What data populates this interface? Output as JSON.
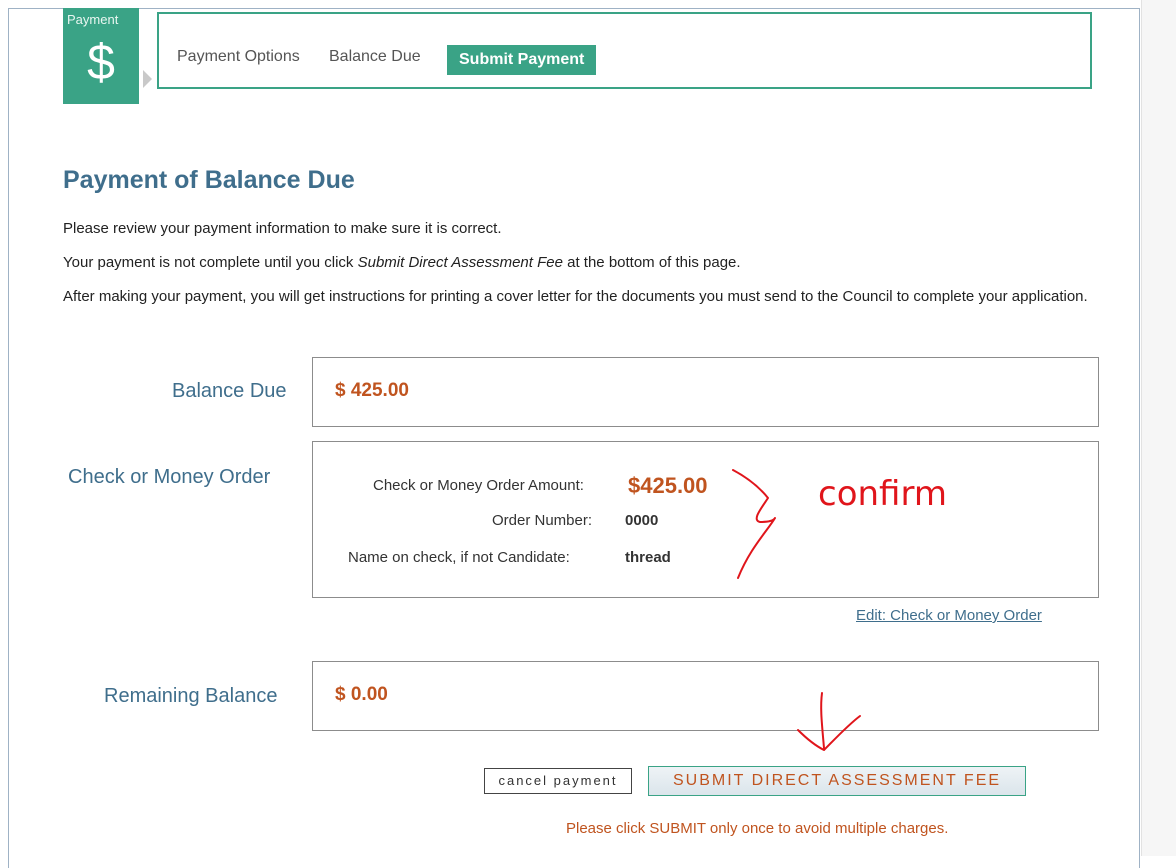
{
  "header": {
    "badge_label": "Payment",
    "badge_icon": "dollar-icon",
    "badge_symbol": "$",
    "steps": [
      "Payment Options",
      "Balance Due"
    ],
    "active_step": "Submit Payment"
  },
  "page": {
    "title": "Payment of Balance Due",
    "intro_1": "Please review your payment information to make sure it is correct.",
    "intro_2_prefix": "Your payment is not complete until you click ",
    "intro_2_italic": "Submit Direct Assessment Fee",
    "intro_2_suffix": " at the bottom of this page.",
    "intro_3": "After making your payment, you will get instructions for printing a cover letter for the documents you must send to the Council to complete your application."
  },
  "balance_due": {
    "label": "Balance Due",
    "amount": "$ 425.00"
  },
  "check": {
    "label": "Check or Money Order",
    "amount_label": "Check or Money Order Amount:",
    "amount_value": "$425.00",
    "order_label": "Order Number:",
    "order_value": "0000",
    "name_label": "Name on check, if not Candidate:",
    "name_value": "thread",
    "edit_link": "Edit: Check or Money Order"
  },
  "remaining": {
    "label": "Remaining Balance",
    "amount": "$ 0.00"
  },
  "actions": {
    "cancel_label": "cancel payment",
    "submit_label": "SUBMIT DIRECT ASSESSMENT FEE",
    "warning": "Please click SUBMIT only once to avoid multiple charges."
  },
  "annotation": {
    "word": "confirm",
    "color": "#e0151b"
  },
  "colors": {
    "accent_green": "#3aa386",
    "heading_blue": "#3f6e8c",
    "amount_orange": "#c0541f"
  }
}
